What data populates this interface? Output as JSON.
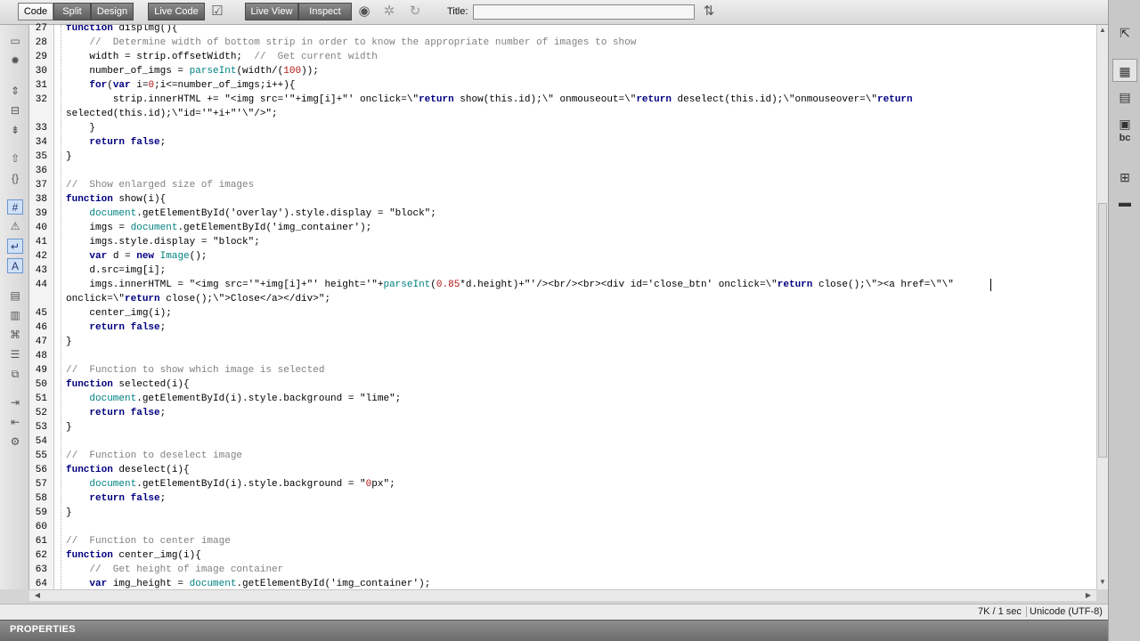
{
  "toolbar": {
    "code_label": "Code",
    "split_label": "Split",
    "design_label": "Design",
    "live_code_label": "Live Code",
    "live_view_label": "Live View",
    "inspect_label": "Inspect",
    "title_label": "Title:",
    "title_value": ""
  },
  "editor": {
    "lines": [
      {
        "n": "27",
        "t": "function displmg(){"
      },
      {
        "n": "28",
        "t": "    //  Determine width of bottom strip in order to know the appropriate number of images to show"
      },
      {
        "n": "29",
        "t": "    width = strip.offsetWidth;  //  Get current width"
      },
      {
        "n": "30",
        "t": "    number_of_imgs = parseInt(width/(100));"
      },
      {
        "n": "31",
        "t": "    for(var i=0;i<=number_of_imgs;i++){"
      },
      {
        "n": "32",
        "t": "        strip.innerHTML += \"<img src='\"+img[i]+\"' onclick=\\\"return show(this.id);\\\" onmouseout=\\\"return deselect(this.id);\\\"onmouseover=\\\"return"
      },
      {
        "n": "",
        "t": "selected(this.id);\\\"id='\"+i+\"'\\\"/>\";"
      },
      {
        "n": "33",
        "t": "    }"
      },
      {
        "n": "34",
        "t": "    return false;"
      },
      {
        "n": "35",
        "t": "}"
      },
      {
        "n": "36",
        "t": ""
      },
      {
        "n": "37",
        "t": "//  Show enlarged size of images"
      },
      {
        "n": "38",
        "t": "function show(i){"
      },
      {
        "n": "39",
        "t": "    document.getElementById('overlay').style.display = \"block\";"
      },
      {
        "n": "40",
        "t": "    imgs = document.getElementById('img_container');"
      },
      {
        "n": "41",
        "t": "    imgs.style.display = \"block\";"
      },
      {
        "n": "42",
        "t": "    var d = new Image();"
      },
      {
        "n": "43",
        "t": "    d.src=img[i];"
      },
      {
        "n": "44",
        "t": "    imgs.innerHTML = \"<img src='\"+img[i]+\"' height='\"+parseInt(0.85*d.height)+\"'/><br/><br><div id='close_btn' onclick=\\\"return close();\\\"><a href=\\\"\\\""
      },
      {
        "n": "",
        "t": "onclick=\\\"return close();\\\">Close</a></div>\";"
      },
      {
        "n": "45",
        "t": "    center_img(i);"
      },
      {
        "n": "46",
        "t": "    return false;"
      },
      {
        "n": "47",
        "t": "}"
      },
      {
        "n": "48",
        "t": ""
      },
      {
        "n": "49",
        "t": "//  Function to show which image is selected"
      },
      {
        "n": "50",
        "t": "function selected(i){"
      },
      {
        "n": "51",
        "t": "    document.getElementById(i).style.background = \"lime\";"
      },
      {
        "n": "52",
        "t": "    return false;"
      },
      {
        "n": "53",
        "t": "}"
      },
      {
        "n": "54",
        "t": ""
      },
      {
        "n": "55",
        "t": "//  Function to deselect image"
      },
      {
        "n": "56",
        "t": "function deselect(i){"
      },
      {
        "n": "57",
        "t": "    document.getElementById(i).style.background = \"0px\";"
      },
      {
        "n": "58",
        "t": "    return false;"
      },
      {
        "n": "59",
        "t": "}"
      },
      {
        "n": "60",
        "t": ""
      },
      {
        "n": "61",
        "t": "//  Function to center image"
      },
      {
        "n": "62",
        "t": "function center_img(i){"
      },
      {
        "n": "63",
        "t": "    //  Get height of image container"
      },
      {
        "n": "64",
        "t": "    var img_height = document.getElementById('img_container');"
      }
    ]
  },
  "statusbar": {
    "size": "7K / 1 sec",
    "encoding": "Unicode (UTF-8)"
  },
  "properties": {
    "title": "PROPERTIES"
  },
  "colors": {
    "keyword": "#000080",
    "comment": "#808080",
    "function": "#008080",
    "number": "#b41414"
  }
}
